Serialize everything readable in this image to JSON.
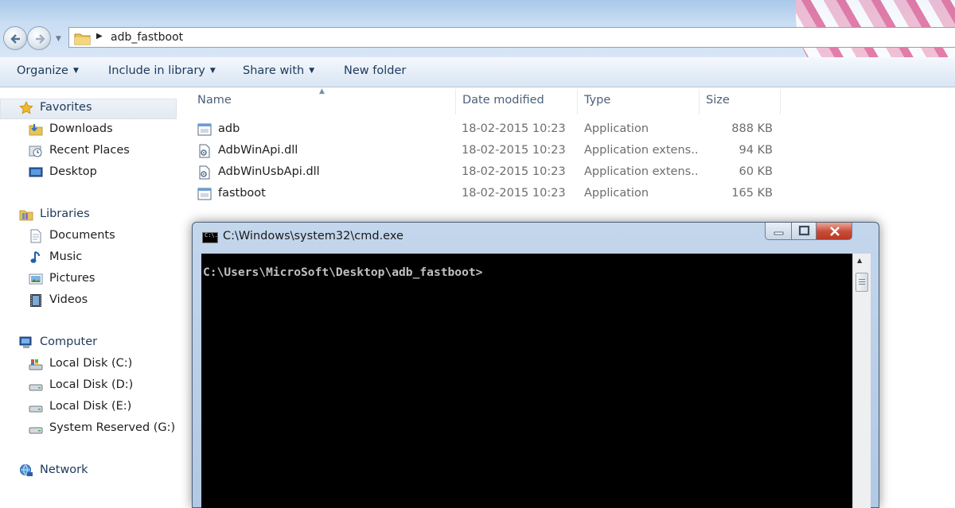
{
  "address": {
    "path": "adb_fastboot"
  },
  "toolbar": {
    "organize": "Organize",
    "include_in_library": "Include in library",
    "share_with": "Share with",
    "new_folder": "New folder"
  },
  "nav": {
    "favorites": {
      "label": "Favorites",
      "items": [
        {
          "label": "Downloads",
          "icon": "downloads-icon"
        },
        {
          "label": "Recent Places",
          "icon": "recent-places-icon"
        },
        {
          "label": "Desktop",
          "icon": "desktop-icon"
        }
      ]
    },
    "libraries": {
      "label": "Libraries",
      "items": [
        {
          "label": "Documents",
          "icon": "documents-icon"
        },
        {
          "label": "Music",
          "icon": "music-icon"
        },
        {
          "label": "Pictures",
          "icon": "pictures-icon"
        },
        {
          "label": "Videos",
          "icon": "videos-icon"
        }
      ]
    },
    "computer": {
      "label": "Computer",
      "items": [
        {
          "label": "Local Disk (C:)",
          "icon": "system-drive-icon"
        },
        {
          "label": "Local Disk (D:)",
          "icon": "drive-icon"
        },
        {
          "label": "Local Disk (E:)",
          "icon": "drive-icon"
        },
        {
          "label": "System Reserved (G:)",
          "icon": "drive-icon"
        }
      ]
    },
    "network": {
      "label": "Network"
    }
  },
  "columns": {
    "name": "Name",
    "date": "Date modified",
    "type": "Type",
    "size": "Size"
  },
  "files": [
    {
      "name": "adb",
      "date": "18-02-2015 10:23",
      "type": "Application",
      "size": "888 KB",
      "icon": "application-icon"
    },
    {
      "name": "AdbWinApi.dll",
      "date": "18-02-2015 10:23",
      "type": "Application extens...",
      "size": "94 KB",
      "icon": "dll-icon"
    },
    {
      "name": "AdbWinUsbApi.dll",
      "date": "18-02-2015 10:23",
      "type": "Application extens...",
      "size": "60 KB",
      "icon": "dll-icon"
    },
    {
      "name": "fastboot",
      "date": "18-02-2015 10:23",
      "type": "Application",
      "size": "165 KB",
      "icon": "application-icon"
    }
  ],
  "cmd": {
    "title": "C:\\Windows\\system32\\cmd.exe",
    "icon_text": "C:\\.",
    "prompt": "C:\\Users\\MicroSoft\\Desktop\\adb_fastboot>"
  },
  "colors": {
    "accent": "#1e395b",
    "console_bg": "#000000",
    "console_fg": "#c0c0c0",
    "close_button": "#c94a35"
  }
}
